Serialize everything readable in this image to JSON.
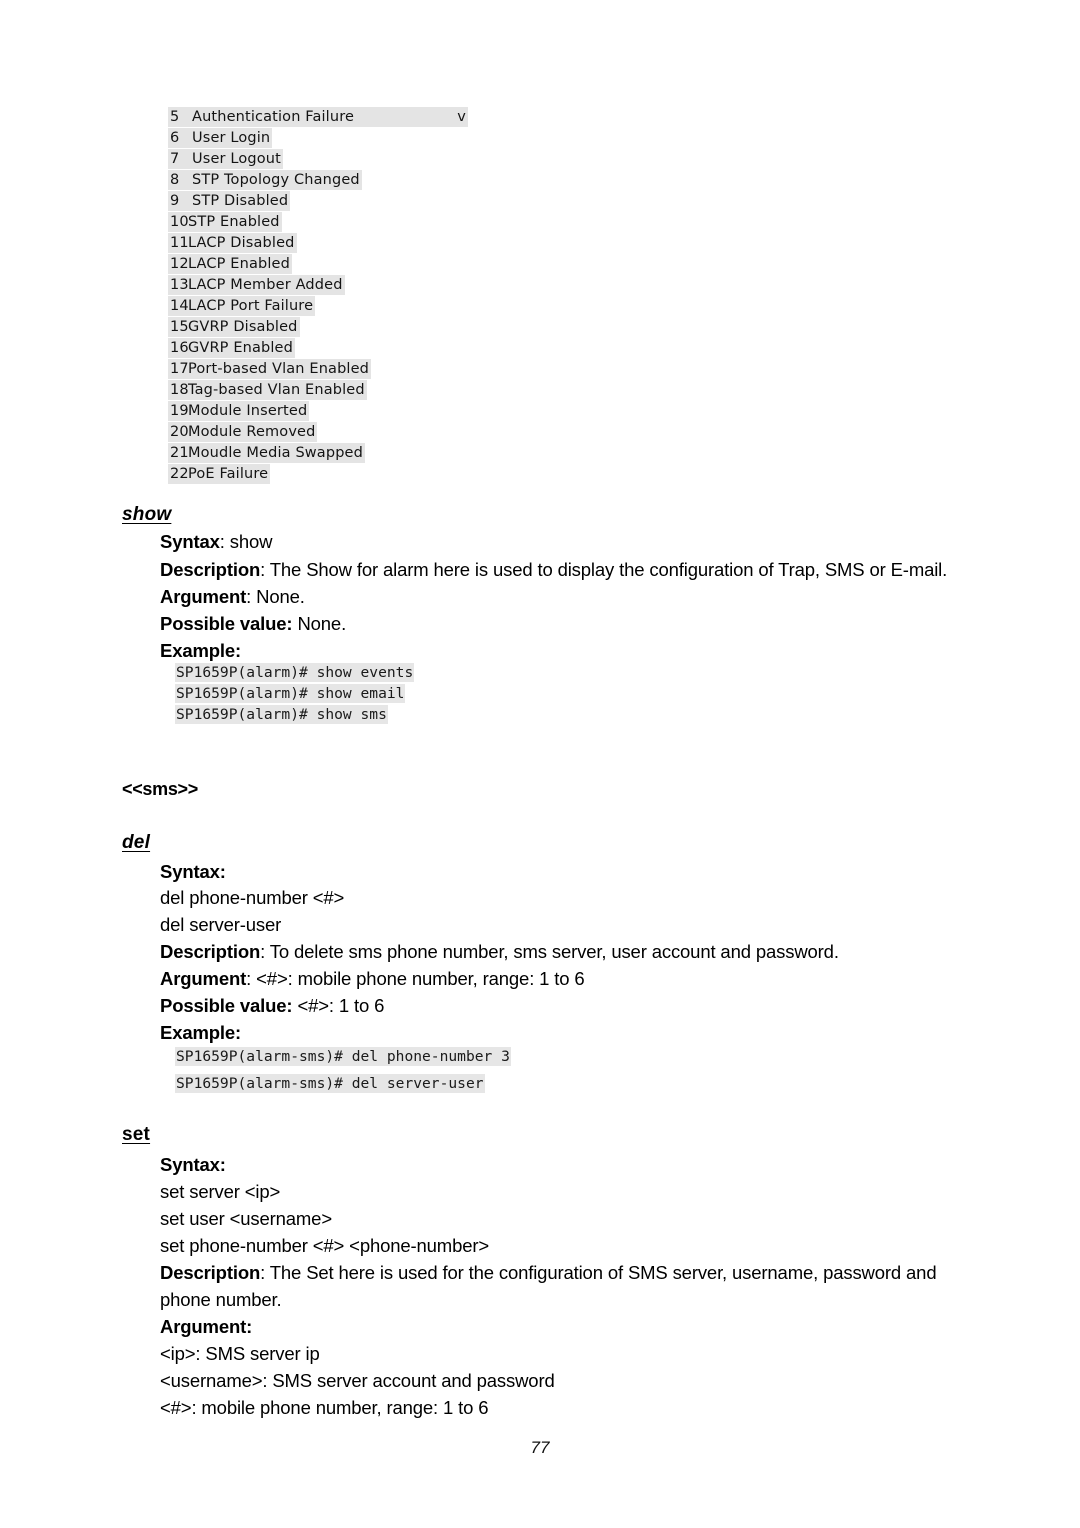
{
  "document": {
    "page_number": "77"
  },
  "event_list": {
    "trailing_marker": "v",
    "items": [
      {
        "num": "5",
        "label": "Authentication Failure"
      },
      {
        "num": "6",
        "label": "User Login"
      },
      {
        "num": "7",
        "label": "User Logout"
      },
      {
        "num": "8",
        "label": "STP Topology Changed"
      },
      {
        "num": "9",
        "label": "STP Disabled"
      },
      {
        "num": "10",
        "label": "STP Enabled"
      },
      {
        "num": "11",
        "label": "LACP Disabled"
      },
      {
        "num": "12",
        "label": "LACP Enabled"
      },
      {
        "num": "13",
        "label": "LACP Member Added"
      },
      {
        "num": "14",
        "label": "LACP Port Failure"
      },
      {
        "num": "15",
        "label": "GVRP Disabled"
      },
      {
        "num": "16",
        "label": "GVRP Enabled"
      },
      {
        "num": "17",
        "label": "Port-based Vlan Enabled"
      },
      {
        "num": "18",
        "label": "Tag-based Vlan Enabled"
      },
      {
        "num": "19",
        "label": "Module Inserted"
      },
      {
        "num": "20",
        "label": "Module Removed"
      },
      {
        "num": "21",
        "label": "Moudle Media Swapped"
      },
      {
        "num": "22",
        "label": "PoE Failure"
      }
    ]
  },
  "show_section": {
    "heading": "show",
    "syntax_label": "Syntax",
    "syntax_value": ": show",
    "description_label": "Description",
    "description_value": ": The Show for alarm here is used to display the configuration of Trap, SMS or E-mail.",
    "argument_label": "Argument",
    "argument_value": ": None.",
    "possible_label": "Possible value:",
    "possible_value": " None.",
    "example_label": "Example:",
    "examples": [
      "SP1659P(alarm)# show events",
      "SP1659P(alarm)# show email",
      "SP1659P(alarm)# show sms"
    ]
  },
  "sms_mode": {
    "heading": "<<sms>>"
  },
  "del_section": {
    "heading": "del",
    "syntax_label": "Syntax:",
    "syntax_lines": [
      "del phone-number <#>",
      "del server-user"
    ],
    "description_label": "Description",
    "description_value": ": To delete sms phone number, sms server, user account and password.",
    "argument_label": "Argument",
    "argument_value": ": <#>: mobile phone number, range: 1 to 6",
    "possible_label": "Possible value:",
    "possible_value": " <#>: 1 to 6",
    "example_label": "Example:",
    "examples": [
      "SP1659P(alarm-sms)# del phone-number 3",
      "SP1659P(alarm-sms)# del server-user"
    ]
  },
  "set_section": {
    "heading": "set",
    "syntax_label": "Syntax:",
    "syntax_lines": [
      "set server <ip>",
      "set user <username>",
      "set phone-number <#> <phone-number>"
    ],
    "description_label": "Description",
    "description_value": ": The Set here is used for the configuration of SMS server, username, password and phone number.",
    "argument_label": "Argument:",
    "argument_lines": [
      "<ip>: SMS server ip",
      "<username>: SMS server account and password",
      "<#>: mobile phone number, range: 1 to 6"
    ]
  }
}
